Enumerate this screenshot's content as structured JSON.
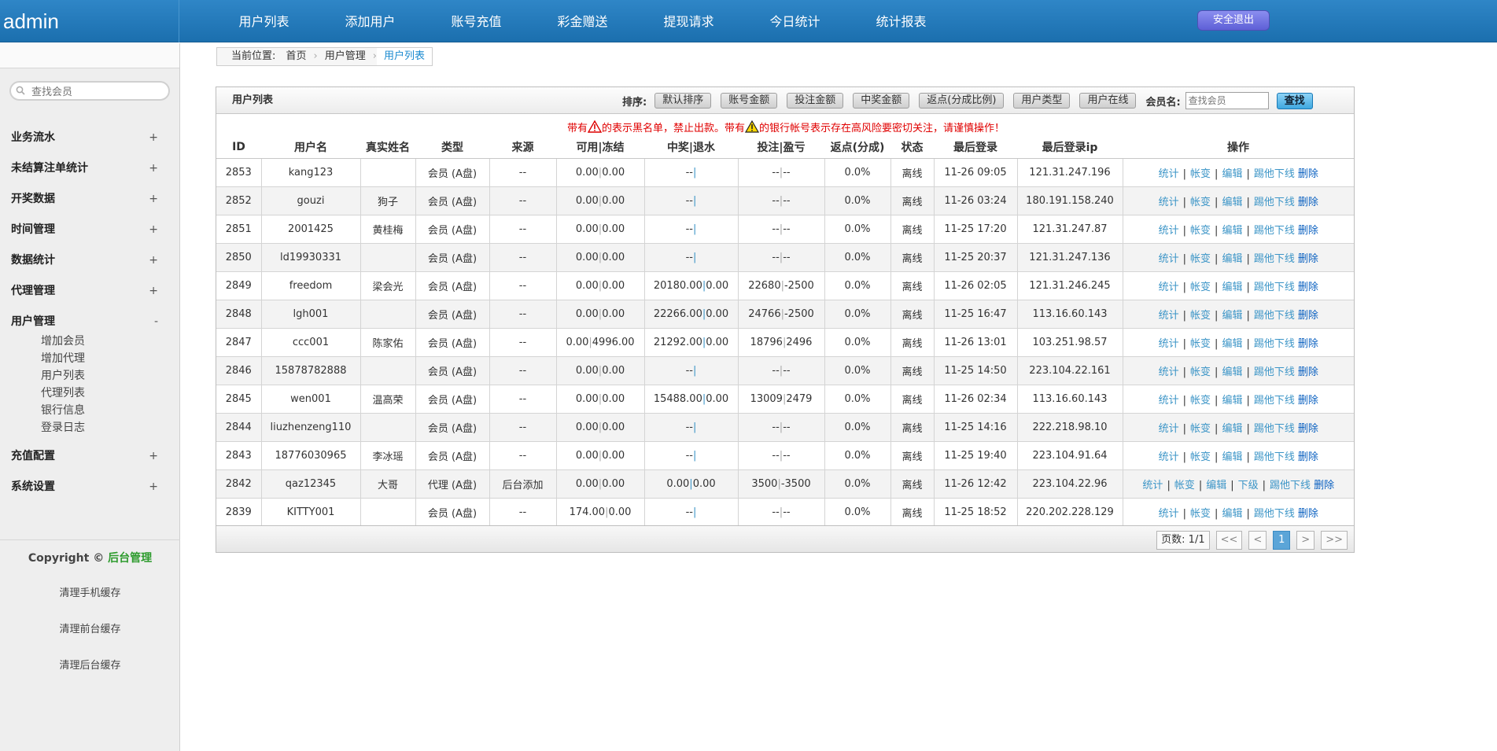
{
  "app": {
    "logo": "admin",
    "logout_label": "安全退出"
  },
  "topnav": [
    "用户列表",
    "添加用户",
    "账号充值",
    "彩金赠送",
    "提现请求",
    "今日统计",
    "统计报表"
  ],
  "sidebar": {
    "search_placeholder": "查找会员",
    "menu": [
      {
        "label": "业务流水",
        "toggle": "+"
      },
      {
        "label": "未结算注单统计",
        "toggle": "+"
      },
      {
        "label": "开奖数据",
        "toggle": "+"
      },
      {
        "label": "时间管理",
        "toggle": "+"
      },
      {
        "label": "数据统计",
        "toggle": "+"
      },
      {
        "label": "代理管理",
        "toggle": "+"
      },
      {
        "label": "用户管理",
        "toggle": "-"
      }
    ],
    "submenu": [
      "增加会员",
      "增加代理",
      "用户列表",
      "代理列表",
      "银行信息",
      "登录日志"
    ],
    "menu_after": [
      {
        "label": "充值配置",
        "toggle": "+"
      },
      {
        "label": "系统设置",
        "toggle": "+"
      }
    ],
    "copyright_prefix": "Copyright ©",
    "copyright_link": "后台管理",
    "clear_buttons": [
      "清理手机缓存",
      "清理前台缓存",
      "清理后台缓存"
    ]
  },
  "breadcrumb": {
    "prefix": "当前位置:",
    "home": "首页",
    "section": "用户管理",
    "current": "用户列表"
  },
  "panel": {
    "title": "用户列表",
    "sort_label": "排序:",
    "sort_buttons": [
      "默认排序",
      "账号金额",
      "投注金额",
      "中奖金额",
      "返点(分成比例)",
      "用户类型",
      "用户在线"
    ],
    "member_label": "会员名:",
    "member_placeholder": "查找会员",
    "find_label": "查找",
    "warning": {
      "part1": "带有",
      "part2": "的表示黑名单，禁止出款。带有",
      "part3": "的银行帐号表示存在高风险要密切关注，请谨慎操作！"
    }
  },
  "table": {
    "headers": [
      "ID",
      "用户名",
      "真实姓名",
      "类型",
      "来源",
      "可用|冻结",
      "中奖|退水",
      "投注|盈亏",
      "返点(分成)",
      "状态",
      "最后登录",
      "最后登录ip",
      "操作"
    ],
    "rows": [
      {
        "id": "2853",
        "username": "kang123",
        "realname": "",
        "type": "会员 (A盘)",
        "source": "--",
        "avail": "0.00",
        "frozen": "0.00",
        "win": "--",
        "rebate": "",
        "bet": "--",
        "profit": "--",
        "point": "0.0%",
        "status": "离线",
        "last_login": "11-26 09:05",
        "ip": "121.31.247.196"
      },
      {
        "id": "2852",
        "username": "gouzi",
        "realname": "狗子",
        "type": "会员 (A盘)",
        "source": "--",
        "avail": "0.00",
        "frozen": "0.00",
        "win": "--",
        "rebate": "",
        "bet": "--",
        "profit": "--",
        "point": "0.0%",
        "status": "离线",
        "last_login": "11-26 03:24",
        "ip": "180.191.158.240"
      },
      {
        "id": "2851",
        "username": "2001425",
        "realname": "黄桂梅",
        "type": "会员 (A盘)",
        "source": "--",
        "avail": "0.00",
        "frozen": "0.00",
        "win": "--",
        "rebate": "",
        "bet": "--",
        "profit": "--",
        "point": "0.0%",
        "status": "离线",
        "last_login": "11-25 17:20",
        "ip": "121.31.247.87"
      },
      {
        "id": "2850",
        "username": "ld19930331",
        "realname": "",
        "type": "会员 (A盘)",
        "source": "--",
        "avail": "0.00",
        "frozen": "0.00",
        "win": "--",
        "rebate": "",
        "bet": "--",
        "profit": "--",
        "point": "0.0%",
        "status": "离线",
        "last_login": "11-25 20:37",
        "ip": "121.31.247.136"
      },
      {
        "id": "2849",
        "username": "freedom",
        "realname": "梁会光",
        "type": "会员 (A盘)",
        "source": "--",
        "avail": "0.00",
        "frozen": "0.00",
        "win": "20180.00",
        "rebate": "0.00",
        "bet": "22680",
        "profit": "-2500",
        "point": "0.0%",
        "status": "离线",
        "last_login": "11-26 02:05",
        "ip": "121.31.246.245"
      },
      {
        "id": "2848",
        "username": "lgh001",
        "realname": "",
        "type": "会员 (A盘)",
        "source": "--",
        "avail": "0.00",
        "frozen": "0.00",
        "win": "22266.00",
        "rebate": "0.00",
        "bet": "24766",
        "profit": "-2500",
        "point": "0.0%",
        "status": "离线",
        "last_login": "11-25 16:47",
        "ip": "113.16.60.143"
      },
      {
        "id": "2847",
        "username": "ccc001",
        "realname": "陈家佑",
        "type": "会员 (A盘)",
        "source": "--",
        "avail": "0.00",
        "frozen": "4996.00",
        "win": "21292.00",
        "rebate": "0.00",
        "bet": "18796",
        "profit": "2496",
        "point": "0.0%",
        "status": "离线",
        "last_login": "11-26 13:01",
        "ip": "103.251.98.57"
      },
      {
        "id": "2846",
        "username": "15878782888",
        "realname": "",
        "type": "会员 (A盘)",
        "source": "--",
        "avail": "0.00",
        "frozen": "0.00",
        "win": "--",
        "rebate": "",
        "bet": "--",
        "profit": "--",
        "point": "0.0%",
        "status": "离线",
        "last_login": "11-25 14:50",
        "ip": "223.104.22.161"
      },
      {
        "id": "2845",
        "username": "wen001",
        "realname": "温高荣",
        "type": "会员 (A盘)",
        "source": "--",
        "avail": "0.00",
        "frozen": "0.00",
        "win": "15488.00",
        "rebate": "0.00",
        "bet": "13009",
        "profit": "2479",
        "point": "0.0%",
        "status": "离线",
        "last_login": "11-26 02:34",
        "ip": "113.16.60.143"
      },
      {
        "id": "2844",
        "username": "liuzhenzeng110",
        "realname": "",
        "type": "会员 (A盘)",
        "source": "--",
        "avail": "0.00",
        "frozen": "0.00",
        "win": "--",
        "rebate": "",
        "bet": "--",
        "profit": "--",
        "point": "0.0%",
        "status": "离线",
        "last_login": "11-25 14:16",
        "ip": "222.218.98.10"
      },
      {
        "id": "2843",
        "username": "18776030965",
        "realname": "李冰瑶",
        "type": "会员 (A盘)",
        "source": "--",
        "avail": "0.00",
        "frozen": "0.00",
        "win": "--",
        "rebate": "",
        "bet": "--",
        "profit": "--",
        "point": "0.0%",
        "status": "离线",
        "last_login": "11-25 19:40",
        "ip": "223.104.91.64"
      },
      {
        "id": "2842",
        "username": "qaz12345",
        "realname": "大哥",
        "type": "代理 (A盘)",
        "source": "后台添加",
        "avail": "0.00",
        "frozen": "0.00",
        "win": "0.00",
        "rebate": "0.00",
        "bet": "3500",
        "profit": "-3500",
        "point": "0.0%",
        "status": "离线",
        "last_login": "11-26 12:42",
        "ip": "223.104.22.96"
      },
      {
        "id": "2839",
        "username": "KITTY001",
        "realname": "",
        "type": "会员 (A盘)",
        "source": "--",
        "avail": "174.00",
        "frozen": "0.00",
        "win": "--",
        "rebate": "",
        "bet": "--",
        "profit": "--",
        "point": "0.0%",
        "status": "离线",
        "last_login": "11-25 18:52",
        "ip": "220.202.228.129"
      }
    ],
    "ops_member": [
      "统计",
      "帐变",
      "编辑",
      "踢他下线",
      "删除"
    ],
    "ops_agent": [
      "统计",
      "帐变",
      "编辑",
      "下级",
      "踢他下线",
      "删除"
    ]
  },
  "pager": {
    "info": "页数: 1/1",
    "first": "<<",
    "prev": "<",
    "page": "1",
    "next": ">",
    "last": ">>"
  }
}
